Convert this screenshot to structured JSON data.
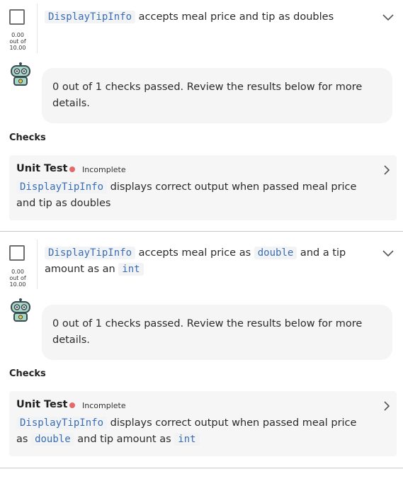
{
  "items": [
    {
      "title_parts": [
        {
          "code": true,
          "text": "DisplayTipInfo"
        },
        {
          "code": false,
          "text": " accepts meal price and tip as doubles"
        }
      ],
      "score": {
        "value": "0.00",
        "out_of": "out of",
        "max": "10.00"
      },
      "summary": "0 out of 1 checks passed. Review the results below for more details.",
      "checks_heading": "Checks",
      "test": {
        "label": "Unit Test",
        "status": "Incomplete",
        "desc_parts": [
          {
            "code": true,
            "text": "DisplayTipInfo"
          },
          {
            "code": false,
            "text": " displays correct output when passed meal price and tip as doubles"
          }
        ]
      }
    },
    {
      "title_parts": [
        {
          "code": true,
          "text": "DisplayTipInfo"
        },
        {
          "code": false,
          "text": " accepts meal price as "
        },
        {
          "code": true,
          "text": "double"
        },
        {
          "code": false,
          "text": " and a tip amount as an "
        },
        {
          "code": true,
          "text": "int"
        }
      ],
      "score": {
        "value": "0.00",
        "out_of": "out of",
        "max": "10.00"
      },
      "summary": "0 out of 1 checks passed. Review the results below for more details.",
      "checks_heading": "Checks",
      "test": {
        "label": "Unit Test",
        "status": "Incomplete",
        "desc_parts": [
          {
            "code": true,
            "text": "DisplayTipInfo"
          },
          {
            "code": false,
            "text": " displays correct output when passed meal price as "
          },
          {
            "code": true,
            "text": "double"
          },
          {
            "code": false,
            "text": " and tip amount as "
          },
          {
            "code": true,
            "text": "int"
          }
        ]
      }
    }
  ],
  "colors": {
    "code_text": "#3b6db3",
    "code_bg": "#f1f3f5",
    "status_incomplete": "#e26a6a",
    "bubble_bg": "#f5f5f6",
    "card_bg": "#f6f6f7"
  },
  "icons": {
    "expand": "chevron-down-icon",
    "open_detail": "chevron-right-icon",
    "assistant": "robot-avatar-icon"
  }
}
